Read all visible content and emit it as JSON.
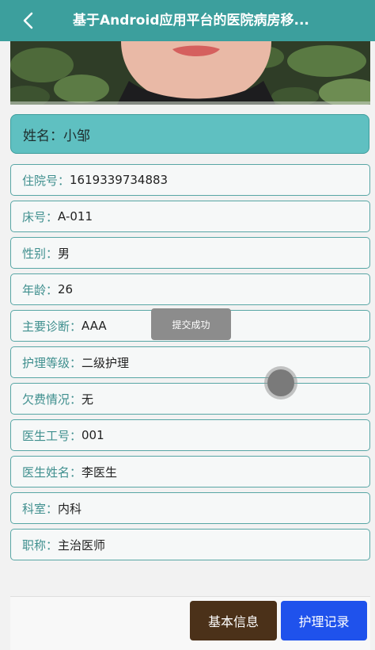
{
  "header": {
    "title": "基于Android应用平台的医院病房移..."
  },
  "patient": {
    "name_label": "姓名：",
    "name_value": "小邹"
  },
  "fields": [
    {
      "label": "住院号：",
      "value": "1619339734883"
    },
    {
      "label": "床号：",
      "value": "A-011"
    },
    {
      "label": "性别：",
      "value": "男"
    },
    {
      "label": "年龄：",
      "value": "26"
    },
    {
      "label": "主要诊断：",
      "value": "AAA"
    },
    {
      "label": "护理等级：",
      "value": "二级护理"
    },
    {
      "label": "欠费情况：",
      "value": "无"
    },
    {
      "label": "医生工号：",
      "value": "001"
    },
    {
      "label": "医生姓名：",
      "value": "李医生"
    },
    {
      "label": "科室：",
      "value": "内科"
    },
    {
      "label": "职称：",
      "value": "主治医师"
    }
  ],
  "toast": {
    "text": "提交成功"
  },
  "buttons": {
    "basic_info": "基本信息",
    "care_records": "护理记录"
  },
  "colors": {
    "header": "#3c9f9d",
    "name_card": "#5fc0c1",
    "label": "#3f8f8e",
    "basic_button": "#4b3119",
    "care_button": "#1f52ec"
  },
  "icons": {
    "back": "chevron-left-icon"
  }
}
